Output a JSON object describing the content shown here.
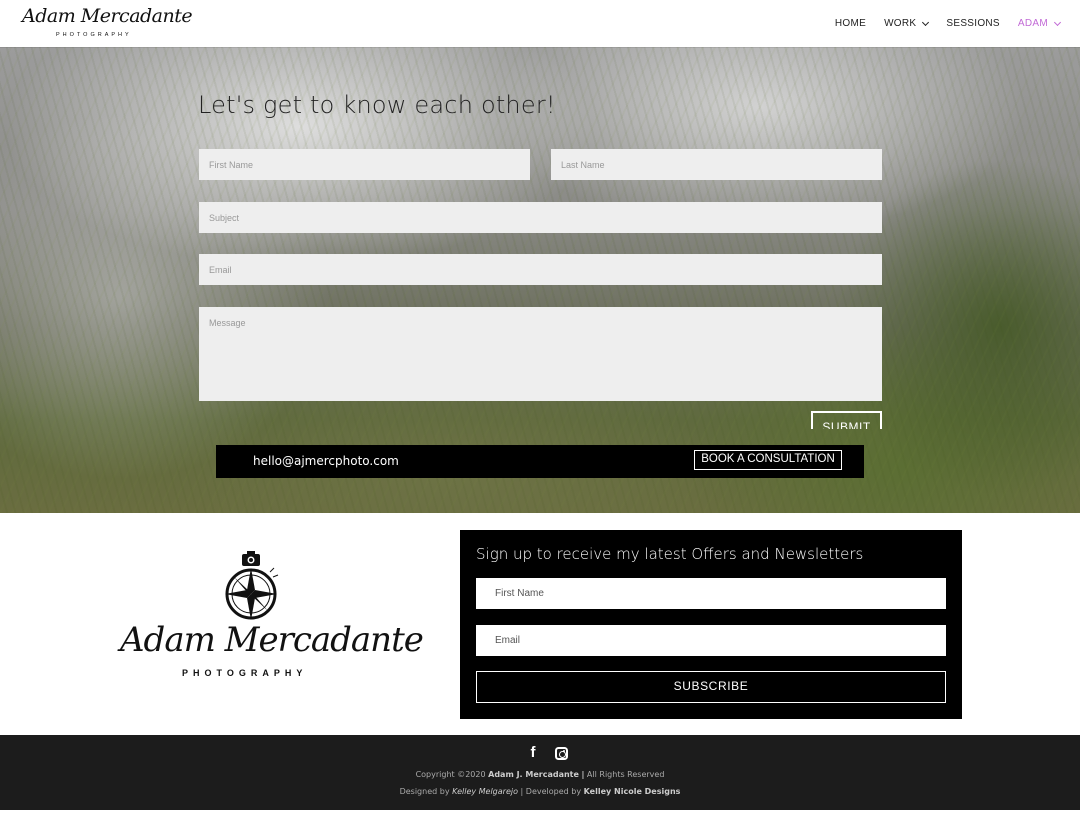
{
  "header": {
    "logo_script": "Adam Mercadante",
    "logo_sub": "PHOTOGRAPHY",
    "nav": [
      {
        "label": "HOME",
        "has_dropdown": false,
        "active": false
      },
      {
        "label": "WORK",
        "has_dropdown": true,
        "active": false
      },
      {
        "label": "SESSIONS",
        "has_dropdown": false,
        "active": false
      },
      {
        "label": "ADAM",
        "has_dropdown": true,
        "active": true
      }
    ],
    "accent_color": "#c26ad6"
  },
  "hero": {
    "title": "Let's get to know each other!",
    "form": {
      "first_name_placeholder": "First Name",
      "last_name_placeholder": "Last Name",
      "subject_placeholder": "Subject",
      "email_placeholder": "Email",
      "message_placeholder": "Message",
      "submit_label": "SUBMIT"
    },
    "contact_email": "hello@ajmercphoto.com",
    "book_label": "BOOK A CONSULTATION"
  },
  "brand": {
    "script": "Adam Mercadante",
    "sub": "PHOTOGRAPHY"
  },
  "newsletter": {
    "title": "Sign up to receive my latest Offers and Newsletters",
    "first_name_placeholder": "First Name",
    "email_placeholder": "Email",
    "subscribe_label": "SUBSCRIBE"
  },
  "footer": {
    "social": [
      "facebook-icon",
      "instagram-icon"
    ],
    "copyright_prefix": "Copyright ©2020",
    "copyright_name": "Adam J. Mercadante",
    "copyright_sep": "|",
    "copyright_suffix": "All Rights Reserved",
    "designed_prefix": "Designed by",
    "designer": "Kelley Melgarejo",
    "developed_prefix": "| Developed by",
    "developer": "Kelley Nicole Designs"
  }
}
